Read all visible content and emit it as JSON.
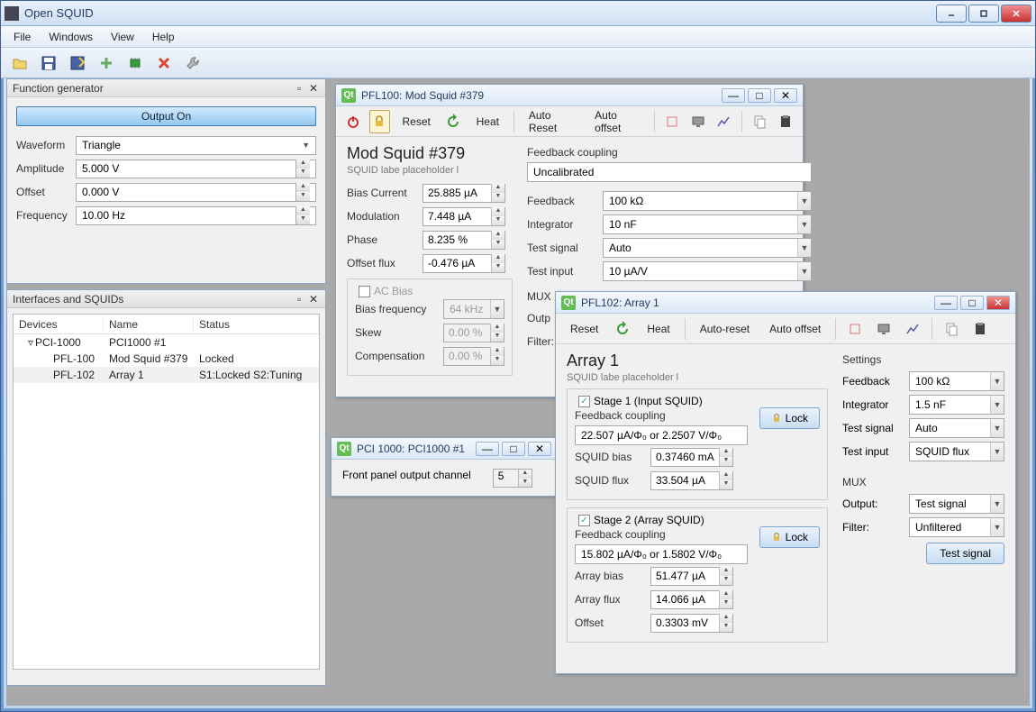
{
  "app": {
    "title": "Open SQUID"
  },
  "menu": {
    "file": "File",
    "windows": "Windows",
    "view": "View",
    "help": "Help"
  },
  "docks": {
    "fg": {
      "title": "Function generator",
      "output_btn": "Output On",
      "waveform_lbl": "Waveform",
      "waveform_val": "Triangle",
      "amplitude_lbl": "Amplitude",
      "amplitude_val": "5.000 V",
      "offset_lbl": "Offset",
      "offset_val": "0.000 V",
      "freq_lbl": "Frequency",
      "freq_val": "10.00 Hz"
    },
    "int": {
      "title": "Interfaces and SQUIDs",
      "cols": {
        "devices": "Devices",
        "name": "Name",
        "status": "Status"
      },
      "rows": [
        {
          "dev": "PCI-1000",
          "name": "PCI1000 #1",
          "status": "",
          "indent": 0,
          "expand": "▿"
        },
        {
          "dev": "PFL-100",
          "name": "Mod Squid #379",
          "status": "Locked",
          "indent": 1
        },
        {
          "dev": "PFL-102",
          "name": "Array 1",
          "status": "S1:Locked  S2:Tuning",
          "indent": 1,
          "sel": true
        }
      ]
    }
  },
  "pfl100": {
    "title": "PFL100: Mod Squid #379",
    "toolbar": {
      "reset": "Reset",
      "heat": "Heat",
      "autoreset": "Auto Reset",
      "autooffset": "Auto offset"
    },
    "h": "Mod Squid #379",
    "ph": "SQUID labe placeholder l",
    "bias_current_lbl": "Bias Current",
    "bias_current_val": "25.885 µA",
    "modulation_lbl": "Modulation",
    "modulation_val": "7.448 µA",
    "phase_lbl": "Phase",
    "phase_val": "8.235 %",
    "offset_flux_lbl": "Offset flux",
    "offset_flux_val": "-0.476 µA",
    "acbias_lbl": "AC Bias",
    "bias_freq_lbl": "Bias frequency",
    "bias_freq_val": "64 kHz",
    "skew_lbl": "Skew",
    "skew_val": "0.00 %",
    "comp_lbl": "Compensation",
    "comp_val": "0.00 %",
    "fc_lbl": "Feedback coupling",
    "fc_val": "Uncalibrated",
    "feedback_lbl": "Feedback",
    "feedback_val": "100 kΩ",
    "integrator_lbl": "Integrator",
    "integrator_val": "10 nF",
    "testsig_lbl": "Test signal",
    "testsig_val": "Auto",
    "testin_lbl": "Test input",
    "testin_val": "10 µA/V",
    "mux_lbl": "MUX",
    "output_lbl": "Outp",
    "filter_lbl": "Filter:"
  },
  "pci1000": {
    "title": "PCI 1000: PCI1000 #1",
    "fp_lbl": "Front panel output channel",
    "fp_val": "5"
  },
  "pfl102": {
    "title": "PFL102: Array 1",
    "toolbar": {
      "reset": "Reset",
      "heat": "Heat",
      "autoreset": "Auto-reset",
      "autooffset": "Auto offset"
    },
    "h": "Array 1",
    "ph": "SQUID labe placeholder l",
    "stage1": {
      "legend": "Stage 1 (Input SQUID)",
      "fc_lbl": "Feedback coupling",
      "fc_val": "22.507 µA/Φ₀ or 2.2507 V/Φ₀",
      "lock": "Lock",
      "bias_lbl": "SQUID bias",
      "bias_val": "0.37460 mA",
      "flux_lbl": "SQUID flux",
      "flux_val": "33.504 µA"
    },
    "stage2": {
      "legend": "Stage 2 (Array SQUID)",
      "fc_lbl": "Feedback coupling",
      "fc_val": "15.802 µA/Φ₀ or 1.5802 V/Φ₀",
      "lock": "Lock",
      "abias_lbl": "Array bias",
      "abias_val": "51.477 µA",
      "aflux_lbl": "Array flux",
      "aflux_val": "14.066 µA",
      "offset_lbl": "Offset",
      "offset_val": "0.3303 mV"
    },
    "settings": {
      "title": "Settings",
      "feedback_lbl": "Feedback",
      "feedback_val": "100 kΩ",
      "integrator_lbl": "Integrator",
      "integrator_val": "1.5 nF",
      "testsig_lbl": "Test signal",
      "testsig_val": "Auto",
      "testin_lbl": "Test input",
      "testin_val": "SQUID flux"
    },
    "mux": {
      "title": "MUX",
      "output_lbl": "Output:",
      "output_val": "Test signal",
      "filter_lbl": "Filter:",
      "filter_val": "Unfiltered",
      "btn": "Test signal"
    }
  }
}
